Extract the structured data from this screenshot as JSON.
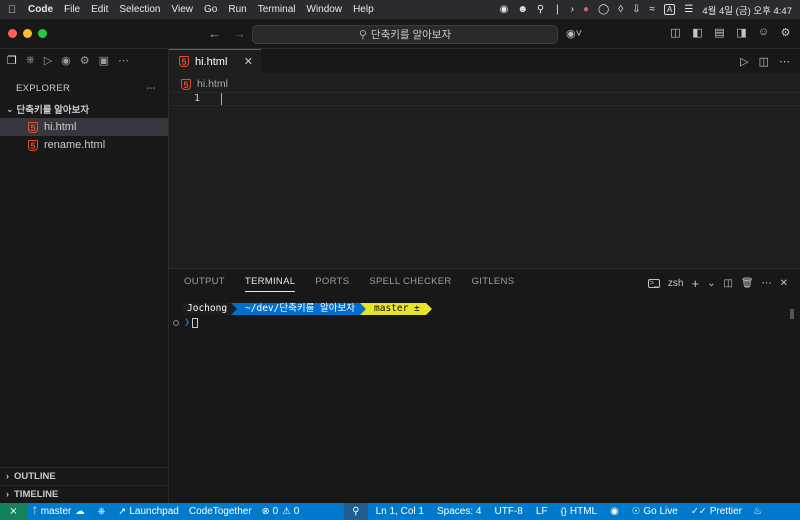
{
  "menubar": {
    "app": "Code",
    "items": [
      "File",
      "Edit",
      "Selection",
      "View",
      "Go",
      "Run",
      "Terminal",
      "Window",
      "Help"
    ],
    "clock": "4월 4일 (금) 오후 4:47"
  },
  "titlebar": {
    "command_center": "단축키를 알아보자"
  },
  "sidebar": {
    "title": "EXPLORER",
    "folder": "단축키를 알아보자",
    "files": [
      "hi.html",
      "rename.html"
    ],
    "outline": "OUTLINE",
    "timeline": "TIMELINE"
  },
  "editor": {
    "tab_label": "hi.html",
    "breadcrumb": "hi.html",
    "line_number": "1"
  },
  "panel": {
    "tabs": [
      "OUTPUT",
      "TERMINAL",
      "PORTS",
      "SPELL CHECKER",
      "GITLENS"
    ],
    "active_tab": "TERMINAL",
    "shell": "zsh",
    "prompt_user": "Jochong",
    "prompt_path": "~/dev/단축키를 알아보자",
    "prompt_git": "master ±"
  },
  "statusbar": {
    "branch": "master",
    "launchpad": "Launchpad",
    "codetogether": "CodeTogether",
    "errors": "0",
    "warnings": "0",
    "position": "Ln 1, Col 1",
    "spaces": "Spaces: 4",
    "encoding": "UTF-8",
    "eol": "LF",
    "language": "HTML",
    "golive": "Go Live",
    "prettier": "Prettier"
  },
  "colors": {
    "accent": "#007acc",
    "remote": "#16825d",
    "git_segment": "#e8e32b",
    "path_segment": "#0070cc",
    "html_icon": "#e44d26"
  }
}
